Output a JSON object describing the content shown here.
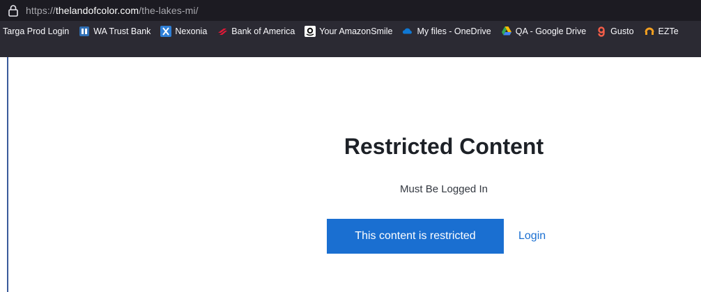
{
  "browser": {
    "url_prefix": "https://",
    "url_host": "thelandofcolor.com",
    "url_path": "/the-lakes-mi/"
  },
  "bookmarks": [
    {
      "label": "Targa Prod Login",
      "icon": "none"
    },
    {
      "label": "WA Trust Bank",
      "icon": "bank-icon",
      "color": "#2f6fb5"
    },
    {
      "label": "Nexonia",
      "icon": "x-icon",
      "color": "#2f7fd6"
    },
    {
      "label": "Bank of America",
      "icon": "boa-icon",
      "color": "#e31837"
    },
    {
      "label": "Your AmazonSmile",
      "icon": "amazon-icon",
      "color": "#ffffff"
    },
    {
      "label": "My files - OneDrive",
      "icon": "cloud-icon",
      "color": "#0f78d4"
    },
    {
      "label": "QA - Google Drive",
      "icon": "drive-icon",
      "color": "#34a853"
    },
    {
      "label": "Gusto",
      "icon": "gusto-icon",
      "color": "#f45d48"
    },
    {
      "label": "EZTe",
      "icon": "ez-icon",
      "color": "#f4a020"
    }
  ],
  "page": {
    "title": "Restricted Content",
    "subtitle": "Must Be Logged In",
    "restricted_button": "This content is restricted",
    "login_link": "Login"
  },
  "colors": {
    "accent": "#1a6fd1",
    "toolbar": "#2b2a33",
    "urlbar": "#1c1b22"
  }
}
